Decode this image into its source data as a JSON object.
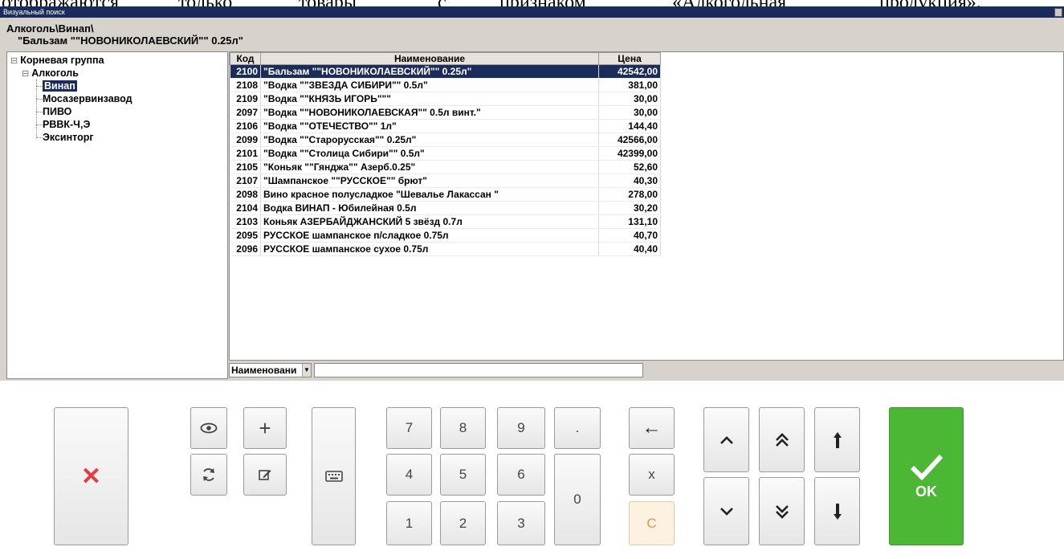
{
  "doc_fragment": {
    "text": [
      "отображаются",
      "только",
      "товары",
      "с",
      "признаком",
      "«Алкогольная",
      "продукция»."
    ]
  },
  "window": {
    "title": "Визуальный поиск"
  },
  "header": {
    "path": "Алкоголь\\Винап\\",
    "selected_name": "\"Бальзам \"\"НОВОНИКОЛАЕВСКИЙ\"\" 0.25л\""
  },
  "tree": {
    "root": "Корневая группа",
    "group": "Алкоголь",
    "children": [
      "Винап",
      "Мосазервинзавод",
      "ПИВО",
      "РВВК-Ч,Э",
      "Эксинторг"
    ],
    "selected_child": "Винап",
    "collapse_glyph": "⊟"
  },
  "grid": {
    "columns": [
      "Код",
      "Наименование",
      "Цена"
    ],
    "rows": [
      {
        "code": "2100",
        "name": "\"Бальзам \"\"НОВОНИКОЛАЕВСКИЙ\"\" 0.25л\"",
        "price": "42542,00"
      },
      {
        "code": "2108",
        "name": "\"Водка \"\"ЗВЕЗДА СИБИРИ\"\" 0.5л\"",
        "price": "381,00"
      },
      {
        "code": "2109",
        "name": "\"Водка \"\"КНЯЗЬ ИГОРЬ\"\"\"",
        "price": "30,00"
      },
      {
        "code": "2097",
        "name": "\"Водка \"\"НОВОНИКОЛАЕВСКАЯ\"\" 0.5л винт.\"",
        "price": "30,00"
      },
      {
        "code": "2106",
        "name": "\"Водка \"\"ОТЕЧЕСТВО\"\" 1л\"",
        "price": "144,40"
      },
      {
        "code": "2099",
        "name": "\"Водка \"\"Старорусская\"\" 0.25л\"",
        "price": "42566,00"
      },
      {
        "code": "2101",
        "name": "\"Водка \"\"Столица Сибири\"\" 0.5л\"",
        "price": "42399,00"
      },
      {
        "code": "2105",
        "name": "\"Коньяк \"\"Гянджа\"\" Азерб.0.25\"",
        "price": "52,60"
      },
      {
        "code": "2107",
        "name": "\"Шампанское \"\"РУССКОЕ\"\" брют\"",
        "price": "40,30"
      },
      {
        "code": "2098",
        "name": "Вино красное полусладкое \"Шевалье Лакассан \"",
        "price": "278,00"
      },
      {
        "code": "2104",
        "name": "Водка ВИНАП - Юбилейная 0.5л",
        "price": "30,20"
      },
      {
        "code": "2103",
        "name": "Коньяк АЗЕРБАЙДЖАНСКИЙ 5 звёзд 0.7л",
        "price": "131,10"
      },
      {
        "code": "2095",
        "name": "РУССКОЕ шампанское п/сладкое 0.75л",
        "price": "40,70"
      },
      {
        "code": "2096",
        "name": "РУССКОЕ шампанское сухое 0.75л",
        "price": "40,40"
      }
    ],
    "selected_index": 0
  },
  "search": {
    "field_label": "Наименовани",
    "value": ""
  },
  "keypad": {
    "cancel": "✕",
    "view_icon": "eye-icon",
    "add": "+",
    "refresh_icon": "refresh-icon",
    "edit_icon": "edit-icon",
    "keyboard_icon": "keyboard-icon",
    "digits": [
      "7",
      "8",
      "9",
      "4",
      "5",
      "6",
      "1",
      "2",
      "3",
      "0"
    ],
    "dot": ".",
    "backspace": "←",
    "x": "x",
    "clear": "C",
    "ok": "OK",
    "ok_color": "#4cb734",
    "cancel_color": "#e23c3c",
    "clear_color": "#e89437"
  }
}
